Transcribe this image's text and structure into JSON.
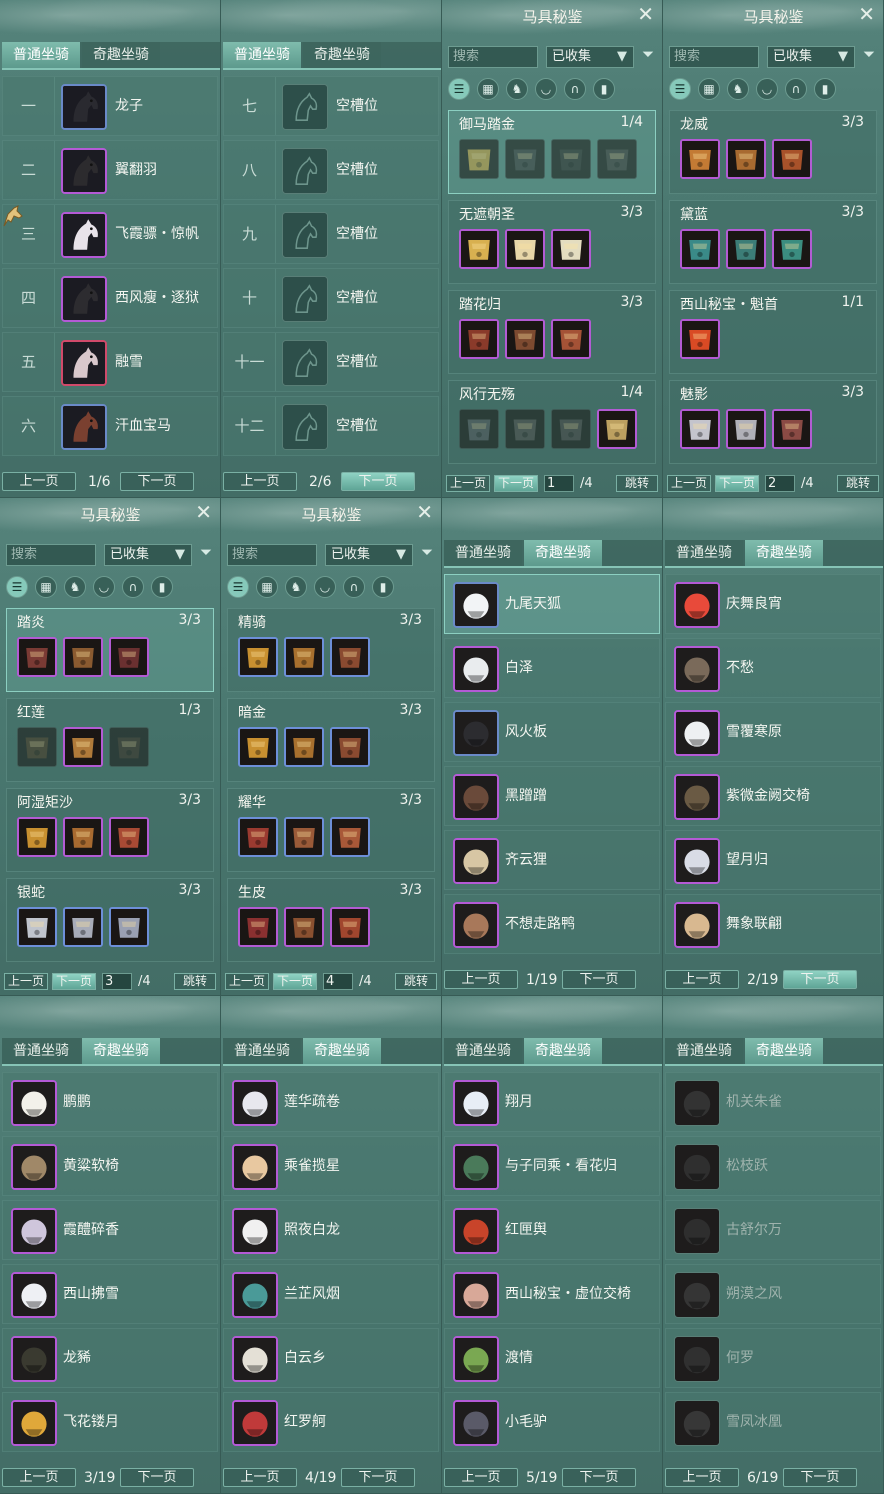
{
  "tabs": {
    "normal": "普通坐骑",
    "fun": "奇趣坐骑"
  },
  "pager": {
    "prev": "上一页",
    "next": "下一页"
  },
  "tack": {
    "title": "马具秘鉴",
    "search_placeholder": "搜索",
    "filter_value": "已收集",
    "jump": "跳转",
    "total": "/4",
    "pages": [
      {
        "current": "1",
        "sets": [
          {
            "name": "御马踏金",
            "count": "1/4"
          },
          {
            "name": "无遮朝圣",
            "count": "3/3"
          },
          {
            "name": "踏花归",
            "count": "3/3"
          },
          {
            "name": "风行无殇",
            "count": "1/4"
          }
        ]
      },
      {
        "current": "2",
        "sets": [
          {
            "name": "龙威",
            "count": "3/3"
          },
          {
            "name": "黛蓝",
            "count": "3/3"
          },
          {
            "name": "西山秘宝・魁首",
            "count": "1/1"
          },
          {
            "name": "魅影",
            "count": "3/3"
          }
        ]
      },
      {
        "current": "3",
        "sets": [
          {
            "name": "踏炎",
            "count": "3/3"
          },
          {
            "name": "红莲",
            "count": "1/3"
          },
          {
            "name": "阿湿矩沙",
            "count": "3/3"
          },
          {
            "name": "银蛇",
            "count": "3/3"
          }
        ]
      },
      {
        "current": "4",
        "sets": [
          {
            "name": "精骑",
            "count": "3/3"
          },
          {
            "name": "暗金",
            "count": "3/3"
          },
          {
            "name": "耀华",
            "count": "3/3"
          },
          {
            "name": "生皮",
            "count": "3/3"
          }
        ]
      }
    ]
  },
  "normal_pages": [
    {
      "page": "1/6",
      "rows": [
        {
          "num": "一",
          "name": "龙子"
        },
        {
          "num": "二",
          "name": "翼翻羽"
        },
        {
          "num": "三",
          "name": "飞霞骠・惊帆"
        },
        {
          "num": "四",
          "name": "西风瘦・逐狱"
        },
        {
          "num": "五",
          "name": "融雪"
        },
        {
          "num": "六",
          "name": "汗血宝马"
        }
      ]
    },
    {
      "page": "2/6",
      "rows": [
        {
          "num": "七",
          "name": "空槽位"
        },
        {
          "num": "八",
          "name": "空槽位"
        },
        {
          "num": "九",
          "name": "空槽位"
        },
        {
          "num": "十",
          "name": "空槽位"
        },
        {
          "num": "十一",
          "name": "空槽位"
        },
        {
          "num": "十二",
          "name": "空槽位"
        }
      ]
    }
  ],
  "fun_pages": [
    {
      "page": "1/19",
      "names": [
        "九尾天狐",
        "白泽",
        "风火板",
        "黑蹭蹭",
        "齐云狸",
        "不想走路鸭"
      ]
    },
    {
      "page": "2/19",
      "names": [
        "庆舞良宵",
        "不愁",
        "雪覆寒原",
        "紫微金阙交椅",
        "望月归",
        "舞象联翩"
      ]
    },
    {
      "page": "3/19",
      "names": [
        "鹏鹏",
        "黄粱软椅",
        "霞醴碎香",
        "西山拂雪",
        "龙豨",
        "飞花镂月"
      ]
    },
    {
      "page": "4/19",
      "names": [
        "莲华疏卷",
        "乘雀揽星",
        "照夜白龙",
        "兰芷风烟",
        "白云乡",
        "红罗舸"
      ]
    },
    {
      "page": "5/19",
      "names": [
        "翔月",
        "与子同乘・看花归",
        "红匣舆",
        "西山秘宝・虚位交椅",
        "渡情",
        "小毛驴"
      ]
    },
    {
      "page": "6/19",
      "names": [
        "机关朱雀",
        "松枝跃",
        "古舒尔万",
        "朔漠之风",
        "何罗",
        "雪凤冰凰"
      ]
    }
  ]
}
